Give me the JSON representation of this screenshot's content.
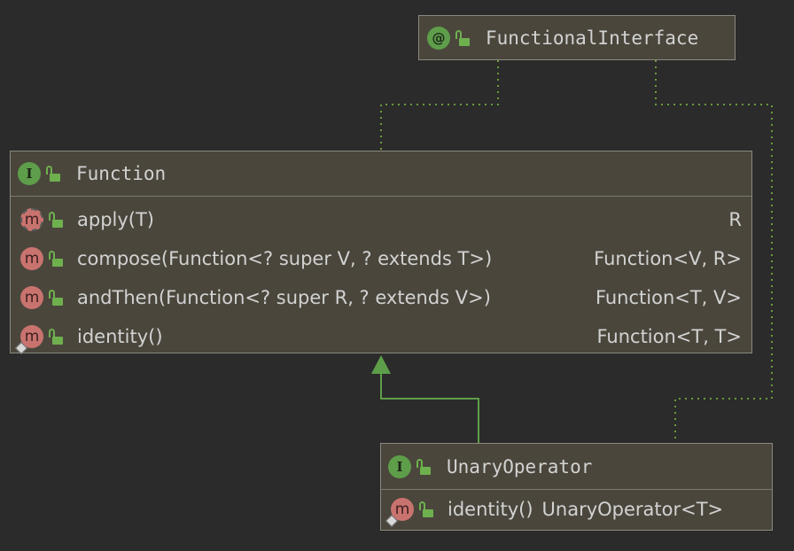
{
  "nodes": {
    "functional_interface": {
      "name": "FunctionalInterface",
      "kind_icon": "annotation-icon",
      "kind_glyph": "@",
      "visibility_icon": "public-lock-icon"
    },
    "function": {
      "name": "Function",
      "kind_icon": "interface-icon",
      "kind_glyph": "I",
      "members": [
        {
          "glyph": "m",
          "signature": "apply(T)",
          "return_type": "R",
          "icon": "abstract-method-icon"
        },
        {
          "glyph": "m",
          "signature": "compose(Function<? super V, ? extends T>)",
          "return_type": "Function<V, R>",
          "icon": "method-icon"
        },
        {
          "glyph": "m",
          "signature": "andThen(Function<? super R, ? extends V>)",
          "return_type": "Function<T, V>",
          "icon": "method-icon"
        },
        {
          "glyph": "m",
          "signature": "identity()",
          "return_type": "Function<T, T>",
          "icon": "static-method-icon"
        }
      ]
    },
    "unary_operator": {
      "name": "UnaryOperator",
      "kind_icon": "interface-icon",
      "kind_glyph": "I",
      "members": [
        {
          "glyph": "m",
          "signature": "identity()",
          "return_type": "UnaryOperator<T>",
          "icon": "static-method-icon"
        }
      ]
    }
  },
  "edges": [
    {
      "from": "Function",
      "to": "FunctionalInterface",
      "type": "annotated-by",
      "style": "dotted"
    },
    {
      "from": "UnaryOperator",
      "to": "FunctionalInterface",
      "type": "annotated-by",
      "style": "dotted"
    },
    {
      "from": "UnaryOperator",
      "to": "Function",
      "type": "extends",
      "style": "solid-arrow"
    }
  ],
  "colors": {
    "background": "#2b2b2b",
    "node_fill": "#4a463c",
    "node_border": "#8a887f",
    "annotation_edge": "#6a9a3c",
    "inheritance_edge": "#5e9e4a",
    "method_badge": "#c9736f",
    "type_badge": "#5e9e4a"
  }
}
